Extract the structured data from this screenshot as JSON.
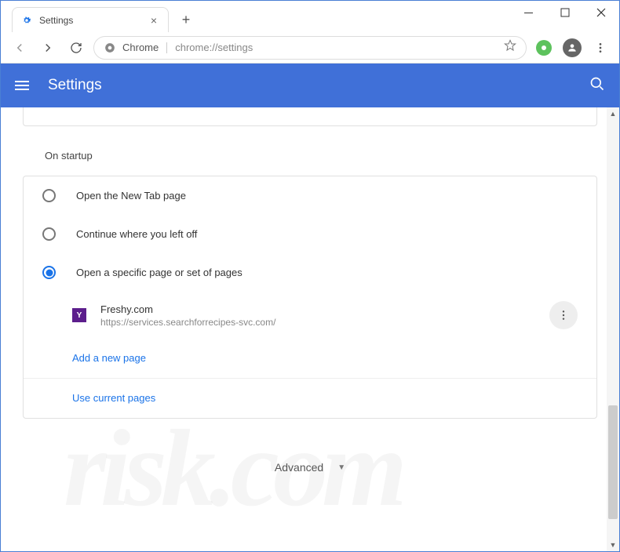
{
  "window": {
    "tab_title": "Settings",
    "tab_icon": "gear-icon"
  },
  "toolbar": {
    "chrome_label": "Chrome",
    "url": "chrome://settings"
  },
  "appbar": {
    "title": "Settings"
  },
  "section": {
    "title": "On startup"
  },
  "startup": {
    "option1": "Open the New Tab page",
    "option2": "Continue where you left off",
    "option3": "Open a specific page or set of pages",
    "selected": 3,
    "pages": [
      {
        "name": "Freshy.com",
        "url": "https://services.searchforrecipes-svc.com/",
        "favicon_letter": "Y"
      }
    ],
    "add_link": "Add a new page",
    "use_current": "Use current pages"
  },
  "advanced": {
    "label": "Advanced"
  }
}
